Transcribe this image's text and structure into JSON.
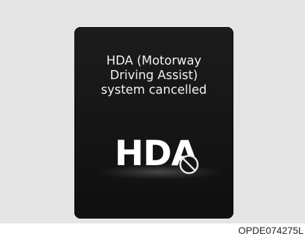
{
  "display": {
    "message_lines": [
      "HDA (Motorway",
      "Driving Assist)",
      "system cancelled"
    ],
    "logo_text": "HDA",
    "logo_icon": "cancel-circle-slash-icon"
  },
  "figure_code": "OPDE074275L",
  "colors": {
    "background_frame": "#e5e5e5",
    "display_background": "#161616",
    "text": "#f2f2f2"
  }
}
